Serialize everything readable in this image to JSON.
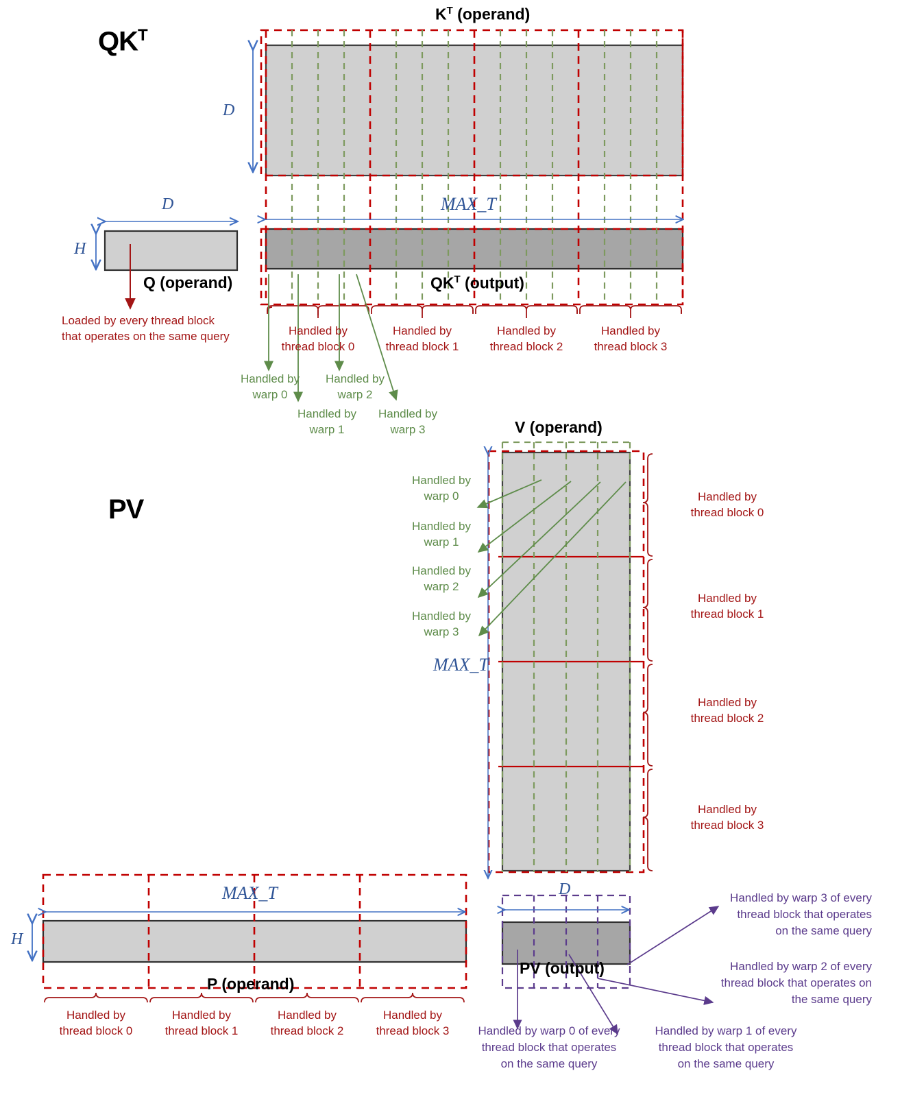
{
  "sections": [
    {
      "id": "qkt",
      "title": "QK",
      "sup": "T"
    },
    {
      "id": "pv",
      "title": "PV",
      "sup": ""
    }
  ],
  "labels": {
    "kt_operand": "K",
    "kt_operand_sup": "T",
    "kt_operand_rest": " (operand)",
    "qkt_output": "QK",
    "qkt_output_sup": "T",
    "qkt_output_rest": " (output)",
    "q_operand": "Q (operand)",
    "v_operand": "V (operand)",
    "p_operand": "P (operand)",
    "pv_output": "PV (output)"
  },
  "dims": {
    "D": "D",
    "H": "H",
    "MAX_T": "MAX_T"
  },
  "notes": {
    "q_loaded_l1": "Loaded by every thread block",
    "q_loaded_l2": "that operates on the same query"
  },
  "thread_blocks": [
    {
      "l1": "Handled by",
      "l2": "thread block 0"
    },
    {
      "l1": "Handled by",
      "l2": "thread block 1"
    },
    {
      "l1": "Handled by",
      "l2": "thread block 2"
    },
    {
      "l1": "Handled by",
      "l2": "thread block 3"
    }
  ],
  "warps": [
    {
      "l1": "Handled by",
      "l2": "warp 0"
    },
    {
      "l1": "Handled by",
      "l2": "warp 1"
    },
    {
      "l1": "Handled by",
      "l2": "warp 2"
    },
    {
      "l1": "Handled by",
      "l2": "warp 3"
    }
  ],
  "pv_warp_notes": [
    {
      "l1": "Handled by warp 0 of every",
      "l2": "thread block that operates",
      "l3": "on the same query"
    },
    {
      "l1": "Handled by warp 1 of every",
      "l2": "thread block that operates",
      "l3": "on the same query"
    },
    {
      "l1": "Handled by warp 2 of every",
      "l2": "thread block that operates on",
      "l3": "the same query"
    },
    {
      "l1": "Handled by warp 3 of every",
      "l2": "thread block that operates",
      "l3": "on the same query"
    }
  ],
  "colors": {
    "operand_fill": "#d0d0d0",
    "output_fill": "#a6a6a6",
    "block_boundary": "#c00000",
    "warp_boundary": "#7d9a5e",
    "dim_arrow": "#4472c4",
    "red_text": "#a31515",
    "green_text": "#5e8c4a",
    "purple_text": "#5b3b8c",
    "matrix_stroke": "#404040"
  }
}
